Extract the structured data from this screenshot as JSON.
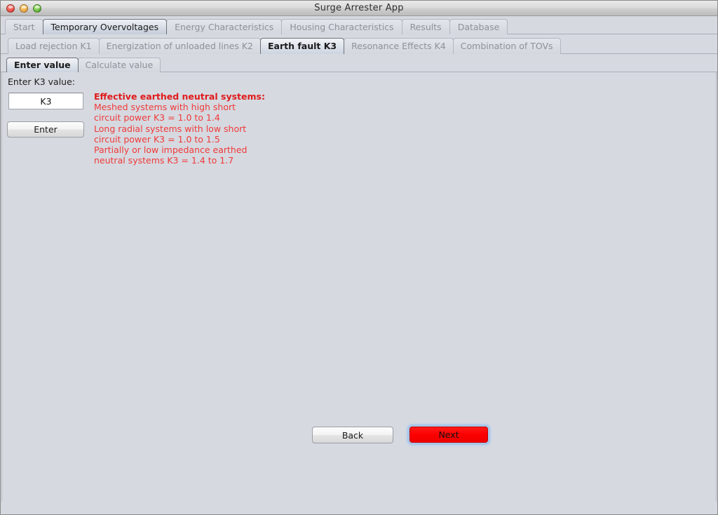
{
  "window": {
    "title": "Surge Arrester App",
    "controls": [
      {
        "name": "close",
        "color": "#e4443b"
      },
      {
        "name": "minimize",
        "color": "#e9a33a"
      },
      {
        "name": "maximize",
        "color": "#5dae36"
      }
    ]
  },
  "main_tabs": [
    {
      "label": "Start",
      "selected": false
    },
    {
      "label": "Temporary Overvoltages",
      "selected": true
    },
    {
      "label": "Energy Characteristics",
      "selected": false
    },
    {
      "label": "Housing Characteristics",
      "selected": false
    },
    {
      "label": "Results",
      "selected": false
    },
    {
      "label": "Database",
      "selected": false
    }
  ],
  "sub_tabs": [
    {
      "label": "Load rejection K1",
      "selected": false
    },
    {
      "label": "Energization of unloaded lines K2",
      "selected": false
    },
    {
      "label": "Earth fault K3",
      "selected": true
    },
    {
      "label": "Resonance Effects K4",
      "selected": false
    },
    {
      "label": "Combination of TOVs",
      "selected": false
    }
  ],
  "mode_tabs": [
    {
      "label": "Enter value",
      "selected": true
    },
    {
      "label": "Calculate value",
      "selected": false
    }
  ],
  "form": {
    "label": "Enter K3 value:",
    "input_value": "K3",
    "input_placeholder": "K3",
    "enter_button": "Enter"
  },
  "hint": {
    "title": "Effective earthed neutral systems:",
    "lines": [
      "Meshed systems with high short",
      "circuit power K3 = 1.0 to 1.4",
      "Long radial systems with low short",
      "circuit power K3 = 1.0 to 1.5",
      "Partially or low impedance earthed",
      "neutral systems K3 = 1.4 to 1.7"
    ],
    "color": "#f03a3a",
    "title_color": "#e01b1b"
  },
  "footer": {
    "back_button": "Back",
    "next_button": "Next",
    "next_button_color": "#fb0000",
    "next_focus_ring_color": "#a9c6e8"
  }
}
